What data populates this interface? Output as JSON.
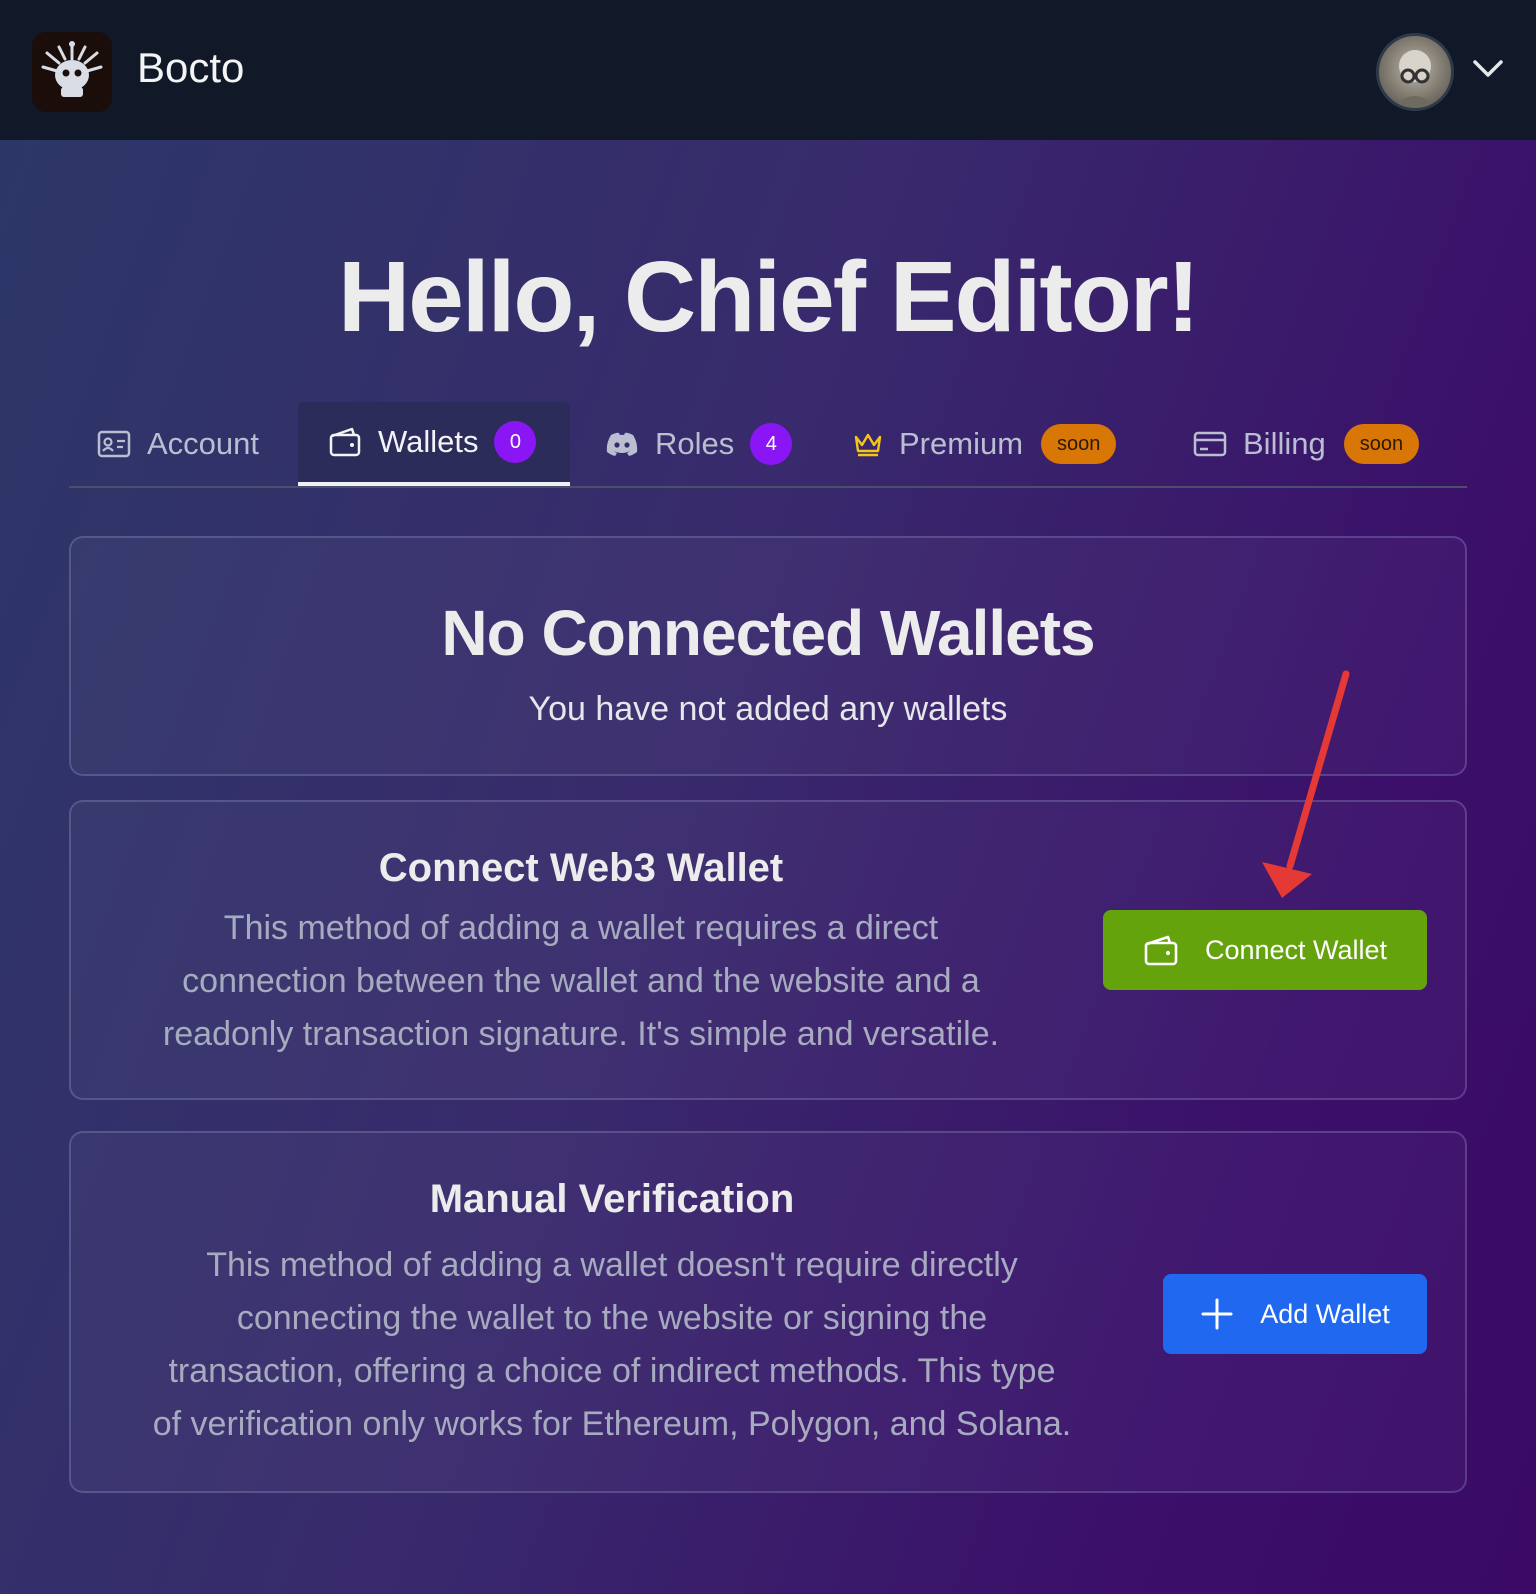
{
  "app": {
    "name": "Bocto"
  },
  "header": {
    "avatar_icon": "user-avatar",
    "menu_icon": "chevron-down-icon"
  },
  "greeting": "Hello, Chief Editor!",
  "tabs": [
    {
      "label": "Account",
      "icon": "id-card-icon",
      "active": false
    },
    {
      "label": "Wallets",
      "icon": "wallet-icon",
      "badge": "0",
      "active": true
    },
    {
      "label": "Roles",
      "icon": "discord-icon",
      "badge": "4",
      "active": false
    },
    {
      "label": "Premium",
      "icon": "crown-icon",
      "tag": "soon",
      "active": false
    },
    {
      "label": "Billing",
      "icon": "credit-card-icon",
      "tag": "soon",
      "active": false
    }
  ],
  "empty_state": {
    "title": "No Connected Wallets",
    "subtitle": "You have not added any wallets"
  },
  "web3": {
    "title": "Connect Web3 Wallet",
    "description_lines": [
      "This method of adding a wallet requires a direct",
      "connection between the wallet and the website and a",
      "readonly transaction signature. It's simple and versatile."
    ],
    "button_label": "Connect Wallet"
  },
  "manual": {
    "title": "Manual Verification",
    "description_lines": [
      "This method of adding a wallet doesn't require directly",
      "connecting the wallet to the website or signing the",
      "transaction, offering a choice of indirect methods. This type",
      "of verification only works for Ethereum, Polygon, and Solana."
    ],
    "button_label": "Add Wallet"
  },
  "colors": {
    "accent_purple": "#8b16f5",
    "soon_orange": "#d97706",
    "connect_green": "#65a30d",
    "add_blue": "#2168f0",
    "annotation_arrow": "#e53935"
  }
}
